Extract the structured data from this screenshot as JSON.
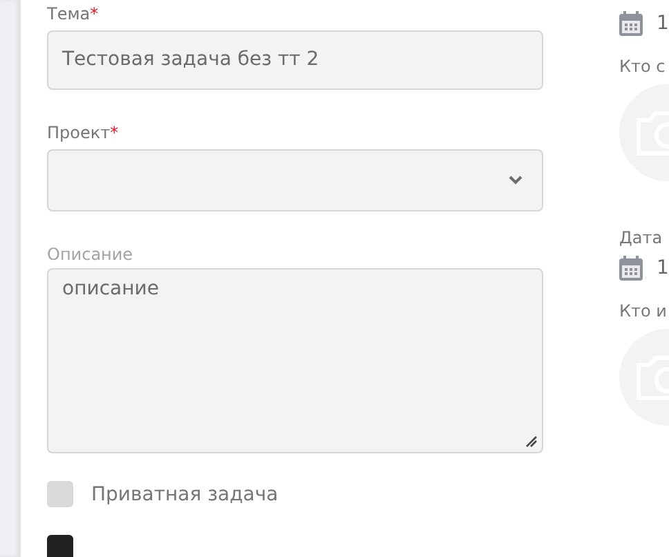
{
  "form": {
    "fields": [
      {
        "kind": "input",
        "label": "Тема",
        "required_mark": "*",
        "value": "Тестовая задача без тт 2"
      },
      {
        "kind": "select",
        "label": "Проект",
        "required_mark": "*"
      },
      {
        "kind": "textarea",
        "label": "Описание",
        "value": "описание"
      }
    ],
    "checkboxes": [
      {
        "label": "Приватная задача",
        "checked": false
      },
      {
        "checked": true
      }
    ]
  },
  "side": [
    {
      "kind": "date",
      "value": "1"
    },
    {
      "kind": "person",
      "label": "Кто с"
    },
    {
      "kind": "label",
      "label": "Дата"
    },
    {
      "kind": "date",
      "value": "1"
    },
    {
      "kind": "person",
      "label": "Кто и"
    }
  ]
}
